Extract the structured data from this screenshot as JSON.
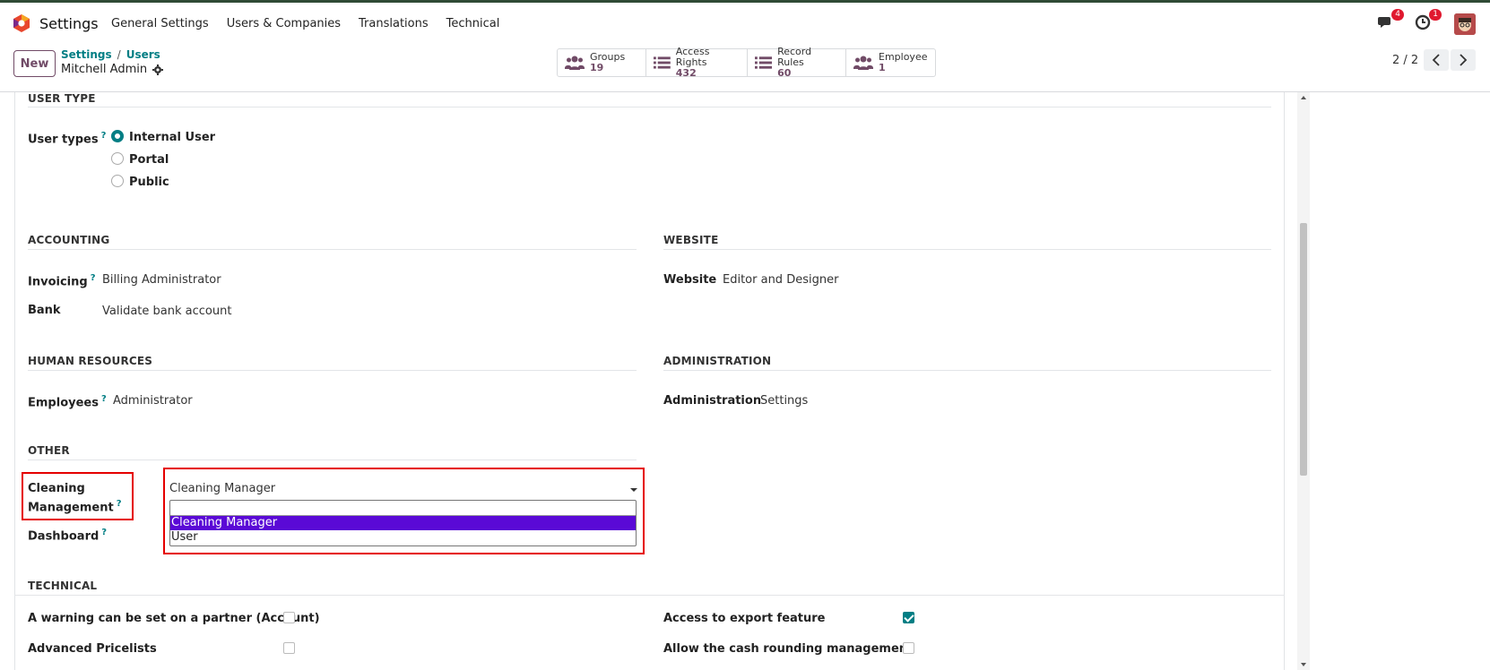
{
  "navbar": {
    "app_name": "Settings",
    "menu": [
      "General Settings",
      "Users & Companies",
      "Translations",
      "Technical"
    ],
    "messages_count": "4",
    "activities_count": "1"
  },
  "control": {
    "new_label": "New",
    "breadcrumb": [
      "Settings",
      "Users"
    ],
    "breadcrumb_sep": "/",
    "record_name": "Mitchell Admin",
    "smart_buttons": [
      {
        "label": "Groups",
        "count": "19",
        "icon": "users-icon"
      },
      {
        "label": "Access Rights",
        "count": "432",
        "icon": "list-icon"
      },
      {
        "label": "Record Rules",
        "count": "60",
        "icon": "list-icon"
      },
      {
        "label": "Employee",
        "count": "1",
        "icon": "users-icon"
      }
    ],
    "pager": "2 / 2"
  },
  "user_type": {
    "section": "USER TYPE",
    "label": "User types",
    "options": [
      "Internal User",
      "Portal",
      "Public"
    ],
    "selected": "Internal User"
  },
  "accounting": {
    "section": "ACCOUNTING",
    "invoicing_label": "Invoicing",
    "invoicing_value": "Billing Administrator",
    "bank_label": "Bank",
    "bank_value": "Validate bank account"
  },
  "website": {
    "section": "WEBSITE",
    "label": "Website",
    "value": "Editor and Designer"
  },
  "hr": {
    "section": "HUMAN RESOURCES",
    "label": "Employees",
    "value": "Administrator"
  },
  "administration": {
    "section": "ADMINISTRATION",
    "label": "Administration",
    "value": "Settings"
  },
  "other": {
    "section": "OTHER",
    "cleaning_label_1": "Cleaning",
    "cleaning_label_2": "Management",
    "cleaning_value": "Cleaning Manager",
    "dropdown_options": [
      "",
      "Cleaning Manager",
      "User"
    ],
    "dashboard_label": "Dashboard"
  },
  "technical": {
    "section": "TECHNICAL",
    "rows_left": [
      {
        "label": "A warning can be set on a partner (Account)",
        "checked": false
      },
      {
        "label": "Advanced Pricelists",
        "checked": false
      }
    ],
    "rows_right": [
      {
        "label": "Access to export feature",
        "checked": true
      },
      {
        "label": "Allow the cash rounding management",
        "checked": false
      }
    ]
  },
  "colors": {
    "brand": "#714b67",
    "accent": "#017e84",
    "highlight": "#e50000",
    "selection": "#5a09d6"
  }
}
